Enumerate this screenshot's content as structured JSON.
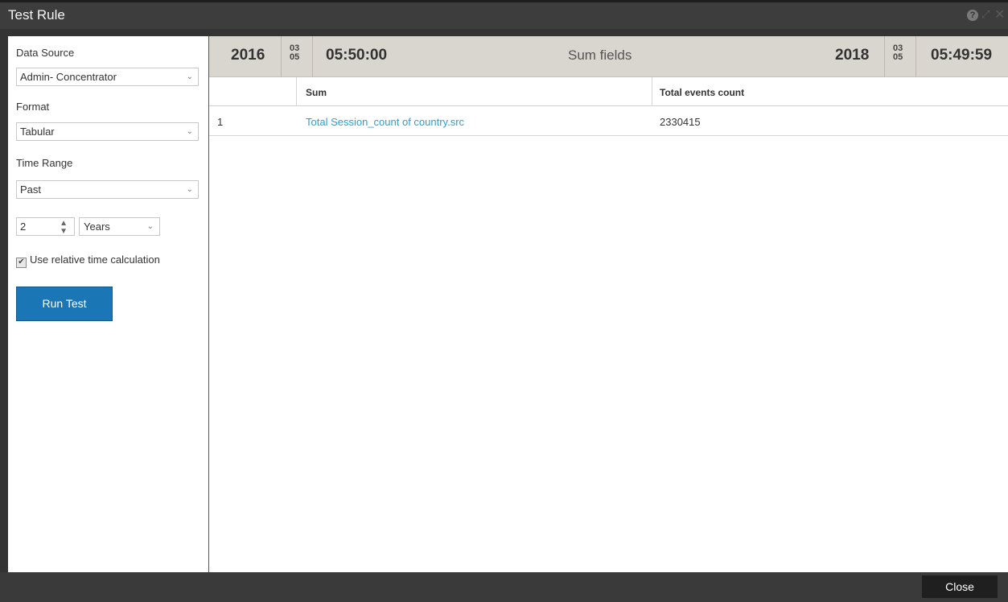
{
  "window": {
    "title": "Test Rule"
  },
  "left": {
    "data_source_label": "Data Source",
    "data_source_value": "Admin- Concentrator",
    "format_label": "Format",
    "format_value": "Tabular",
    "time_range_label": "Time Range",
    "time_range_value": "Past",
    "amount_value": "2",
    "unit_value": "Years",
    "relative_label": "Use relative time calculation",
    "relative_checked": true,
    "run_label": "Run Test"
  },
  "timebar": {
    "start_year": "2016",
    "start_month": "03",
    "start_day": "05",
    "start_time": "05:50:00",
    "title": "Sum fields",
    "end_year": "2018",
    "end_month": "03",
    "end_day": "05",
    "end_time": "05:49:59"
  },
  "table": {
    "columns": [
      "Sum",
      "Total events count"
    ],
    "rows": [
      {
        "index": "1",
        "sum": "Total Session_count of country.src",
        "count": "2330415"
      }
    ]
  },
  "footer": {
    "close_label": "Close"
  },
  "colors": {
    "accent": "#1b76b5",
    "link": "#2a9fd6",
    "titlebar": "#3d3d3d"
  }
}
